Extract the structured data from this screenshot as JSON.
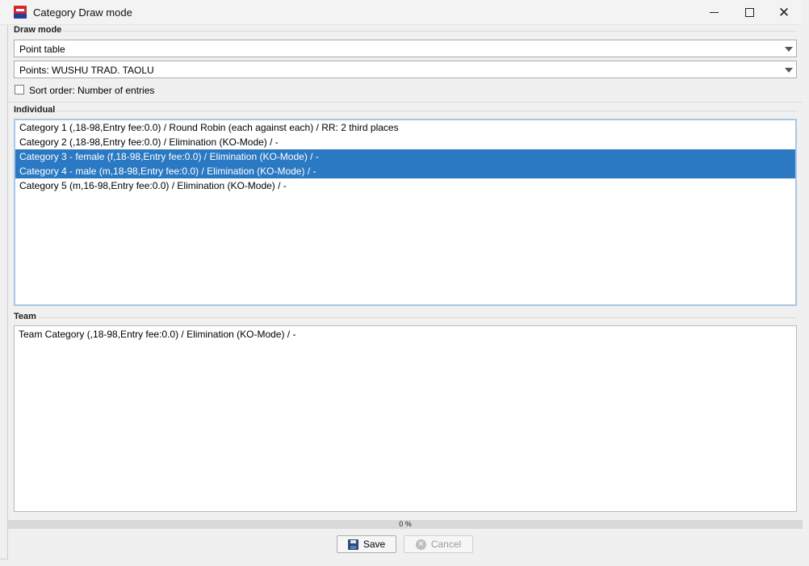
{
  "window": {
    "title": "Category Draw mode",
    "icon": "app-flag-icon",
    "controls": {
      "minimize": "minimize-icon",
      "maximize": "maximize-icon",
      "close": "✕"
    }
  },
  "draw_mode": {
    "label": "Draw mode",
    "mode_select": {
      "value": "Point table"
    },
    "points_select": {
      "value": "Points: WUSHU TRAD. TAOLU"
    },
    "sort_checkbox": {
      "label": "Sort order: Number of entries",
      "checked": false
    }
  },
  "individual": {
    "label": "Individual",
    "items": [
      {
        "text": "Category 1 (,18-98,Entry fee:0.0) / Round Robin (each against each) / RR: 2 third places",
        "selected": false
      },
      {
        "text": "Category 2 (,18-98,Entry fee:0.0) / Elimination (KO-Mode) / -",
        "selected": false
      },
      {
        "text": "Category 3 - female (f,18-98,Entry fee:0.0) / Elimination (KO-Mode) / -",
        "selected": true
      },
      {
        "text": "Category 4 - male (m,18-98,Entry fee:0.0) / Elimination (KO-Mode) / -",
        "selected": true
      },
      {
        "text": "Category 5 (m,16-98,Entry fee:0.0) / Elimination (KO-Mode) / -",
        "selected": false
      }
    ]
  },
  "team": {
    "label": "Team",
    "items": [
      {
        "text": "Team Category (,18-98,Entry fee:0.0) / Elimination (KO-Mode) / -",
        "selected": false
      }
    ]
  },
  "progress": {
    "label": "0 %",
    "value": 0
  },
  "buttons": {
    "save": {
      "label": "Save",
      "icon": "floppy-disk-icon"
    },
    "cancel": {
      "label": "Cancel",
      "icon": "cancel-icon",
      "disabled": true
    }
  },
  "colors": {
    "selection": "#2b79c2",
    "focus_border": "#a6c7e6"
  }
}
